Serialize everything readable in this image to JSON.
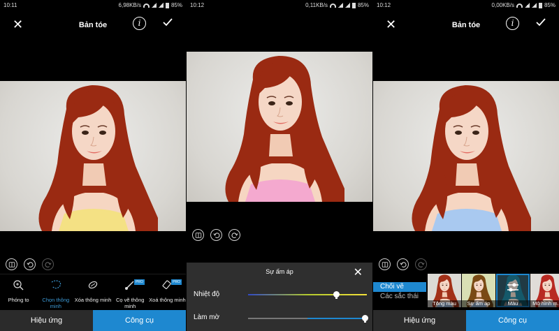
{
  "screens": [
    {
      "status": {
        "time": "10:11",
        "speed": "6,98KB/s",
        "battery": "85%"
      },
      "title": "Bản tóe",
      "tools": [
        {
          "label": "Phóng to",
          "icon": "zoom-icon",
          "pro": false
        },
        {
          "label": "Chọn thông minh",
          "icon": "smart-select-icon",
          "pro": false
        },
        {
          "label": "Xóa thông minh",
          "icon": "eraser-icon",
          "pro": false
        },
        {
          "label": "Cọ vẽ thông minh",
          "icon": "brush-icon",
          "pro": true
        },
        {
          "label": "Xoá thông minh",
          "icon": "smart-erase-icon",
          "pro": true
        }
      ],
      "active_tool": 1,
      "tabs": [
        "Hiệu ứng",
        "Công cụ"
      ],
      "active_tab": 1
    },
    {
      "status": {
        "time": "10:12",
        "speed": "0,11KB/s",
        "battery": "85%"
      },
      "panel": {
        "title": "Sự ấm áp",
        "sliders": [
          {
            "label": "Nhiệt độ",
            "value": 0.74
          },
          {
            "label": "Làm mờ",
            "value": 0.98
          }
        ]
      }
    },
    {
      "status": {
        "time": "10:12",
        "speed": "0,00KB/s",
        "battery": "85%"
      },
      "title": "Bản tóe",
      "menu": [
        "Chối vẽ",
        "Các sắc thái"
      ],
      "active_menu": 0,
      "effects": [
        {
          "label": "Tông màu",
          "hair": "#a23018"
        },
        {
          "label": "Sự ấm áp",
          "hair": "#7a4a14"
        },
        {
          "label": "Màu",
          "hair": "#0e6e84"
        },
        {
          "label": "Mô hình m...",
          "hair": "#b82a22"
        }
      ],
      "selected_effect": 2,
      "tabs": [
        "Hiệu ứng",
        "Công cụ"
      ],
      "active_tab": 1
    }
  ],
  "colors": {
    "accent": "#1e88d0",
    "hair": "#9a2a12",
    "top_pink": "#f4a9cf",
    "top_yellow": "#f4e184",
    "top_blue": "#a9c9f0"
  }
}
